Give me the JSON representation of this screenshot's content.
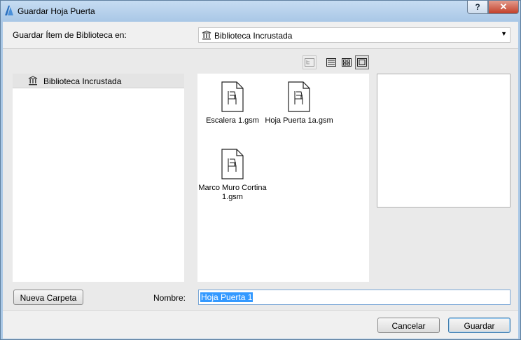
{
  "window": {
    "title": "Guardar Hoja Puerta",
    "help_label": "?",
    "close_label": "✕",
    "accent": "#aac8e6"
  },
  "header": {
    "save_in_label": "Guardar Ítem de Biblioteca en:",
    "location_value": "Biblioteca Incrustada",
    "location_icon": "library-icon"
  },
  "toolbar": {
    "views": [
      {
        "name": "tree-view-icon",
        "state": "disabled"
      },
      {
        "name": "list-view-icon",
        "state": "normal"
      },
      {
        "name": "small-icons-view-icon",
        "state": "normal"
      },
      {
        "name": "large-icons-view-icon",
        "state": "active"
      }
    ]
  },
  "sidebar": {
    "items": [
      {
        "label": "Biblioteca Incrustada",
        "icon": "library-icon",
        "selected": true
      }
    ]
  },
  "files": [
    {
      "name": "Escalera 1.gsm",
      "icon": "chair-file-icon"
    },
    {
      "name": "Hoja Puerta 1a.gsm",
      "icon": "chair-file-icon"
    },
    {
      "name": "Marco Muro Cortina 1.gsm",
      "icon": "chair-file-icon"
    }
  ],
  "form": {
    "new_folder_label": "Nueva Carpeta",
    "name_label": "Nombre:",
    "name_value": "Hoja Puerta 1",
    "selection_color": "#3399ff"
  },
  "footer": {
    "cancel_label": "Cancelar",
    "save_label": "Guardar"
  }
}
